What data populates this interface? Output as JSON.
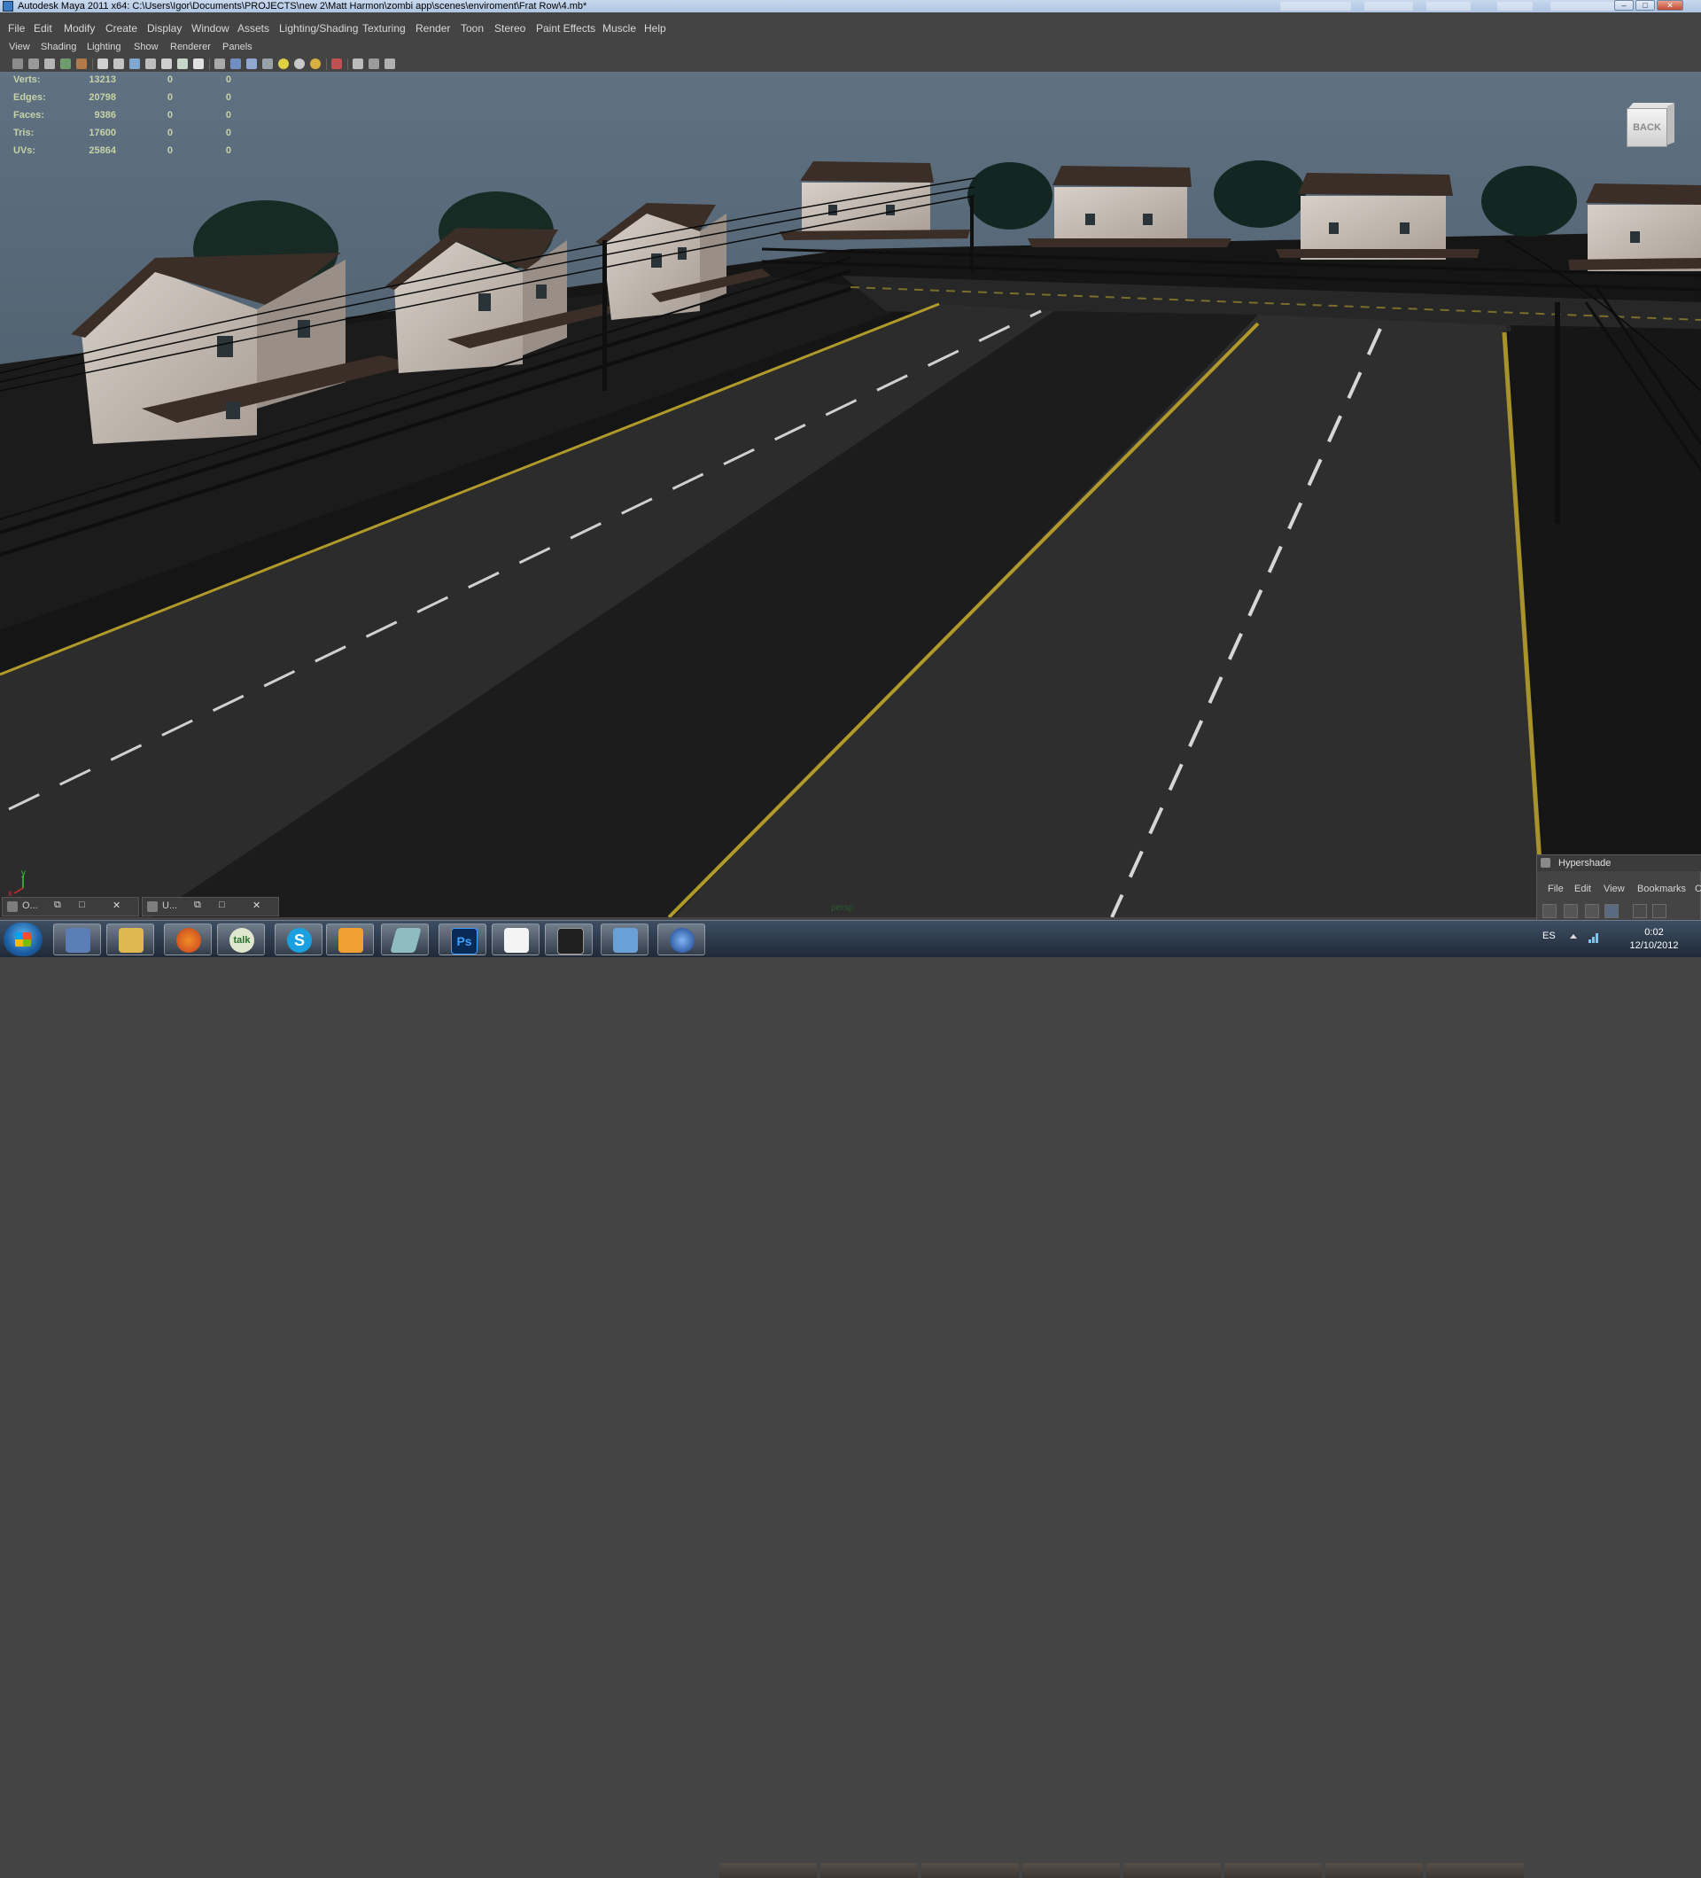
{
  "window": {
    "title": "Autodesk Maya 2011 x64: C:\\Users\\Igor\\Documents\\PROJECTS\\new 2\\Matt Harmon\\zombi app\\scenes\\enviroment\\Frat Row\\4.mb*",
    "controls": {
      "minimize": "–",
      "maximize": "□",
      "close": "✕"
    }
  },
  "menubar": [
    "File",
    "Edit",
    "Modify",
    "Create",
    "Display",
    "Window",
    "Assets",
    "Lighting/Shading",
    "Texturing",
    "Render",
    "Toon",
    "Stereo",
    "Paint Effects",
    "Muscle",
    "Help"
  ],
  "panel_menu": [
    "View",
    "Shading",
    "Lighting",
    "Show",
    "Renderer",
    "Panels"
  ],
  "panel_toolbar_icons": [
    "select-camera-icon",
    "camera-attributes-icon",
    "bookmark-icon",
    "image-plane-icon",
    "two-d-pan-icon",
    "grease-pencil-icon",
    "grid-icon",
    "film-gate-icon",
    "resolution-gate-icon",
    "gate-mask-icon",
    "field-chart-icon",
    "safe-action-icon",
    "safe-title-icon",
    "wireframe-icon",
    "smooth-shade-icon",
    "flat-shade-icon",
    "bounding-box-icon",
    "default-light-icon",
    "textured-icon",
    "shadows-icon",
    "xray-icon",
    "isolate-select-icon",
    "xray-joints-icon",
    "backface-icon"
  ],
  "heads_up": {
    "rows": [
      {
        "label": "Verts:",
        "values": [
          "13213",
          "0",
          "0"
        ]
      },
      {
        "label": "Edges:",
        "values": [
          "20798",
          "0",
          "0"
        ]
      },
      {
        "label": "Faces:",
        "values": [
          "9386",
          "0",
          "0"
        ]
      },
      {
        "label": "Tris:",
        "values": [
          "17600",
          "0",
          "0"
        ]
      },
      {
        "label": "UVs:",
        "values": [
          "25864",
          "0",
          "0"
        ]
      }
    ]
  },
  "viewcube": {
    "label": "BACK"
  },
  "axis": {
    "x": "x",
    "y": "y"
  },
  "camera_label": "persp",
  "minimized_windows": [
    {
      "label": "O...",
      "buttons": [
        "⧉",
        "□",
        "✕"
      ]
    },
    {
      "label": "U...",
      "buttons": [
        "⧉",
        "□",
        "✕"
      ]
    }
  ],
  "hypershade": {
    "title": "Hypershade",
    "menu": [
      "File",
      "Edit",
      "View",
      "Bookmarks",
      "C"
    ]
  },
  "taskbar": {
    "apps": [
      {
        "name": "computer-icon",
        "label": ""
      },
      {
        "name": "explorer-icon",
        "label": ""
      },
      {
        "name": "firefox-icon",
        "label": ""
      },
      {
        "name": "google-talk-icon",
        "label": "talk"
      },
      {
        "name": "skype-icon",
        "label": "S"
      },
      {
        "name": "media-player-icon",
        "label": ""
      },
      {
        "name": "maya-icon",
        "label": ""
      },
      {
        "name": "photoshop-icon",
        "label": "Ps"
      },
      {
        "name": "document-icon",
        "label": ""
      },
      {
        "name": "hand-icon",
        "label": ""
      },
      {
        "name": "photo-viewer-icon",
        "label": ""
      },
      {
        "name": "globe-icon",
        "label": ""
      }
    ],
    "tray": {
      "language": "ES",
      "time": "0:02",
      "date": "12/10/2012"
    }
  },
  "colors": {
    "sky_top": "#5f7182",
    "sky_bottom": "#3f4e5a",
    "ground": "#161616",
    "road": "#2c2c2c",
    "yellow_line": "#b09a2a",
    "hud_text": "#c8d2a8"
  }
}
